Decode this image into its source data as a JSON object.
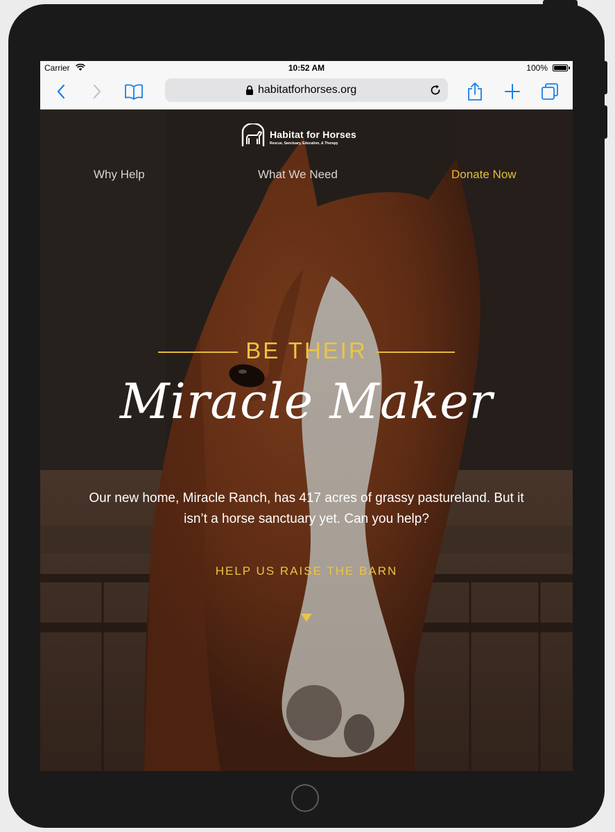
{
  "status_bar": {
    "carrier": "Carrier",
    "time": "10:52 AM",
    "battery": "100%"
  },
  "browser": {
    "url": "habitatforhorses.org",
    "icons": [
      "back-icon",
      "forward-icon",
      "bookmarks-icon",
      "lock-icon",
      "reload-icon",
      "share-icon",
      "new-tab-icon",
      "tabs-icon"
    ]
  },
  "site": {
    "logo_title": "Habitat for Horses",
    "logo_subtitle": "Rescue, Sanctuary, Education, & Therapy",
    "nav": [
      "Why Help",
      "What We Need",
      "Donate Now"
    ],
    "hero_eyebrow": "BE THEIR",
    "hero_title": "Miracle Maker",
    "hero_text": "Our new home, Miracle Ranch, has 417 acres of grassy pastureland. But it isn’t a horse sanctuary yet. Can you help?",
    "cta": "HELP US RAISE THE BARN"
  },
  "colors": {
    "accent": "#ECC445",
    "browser_blue": "#1A7FE8",
    "device": "#1A1A1A"
  }
}
